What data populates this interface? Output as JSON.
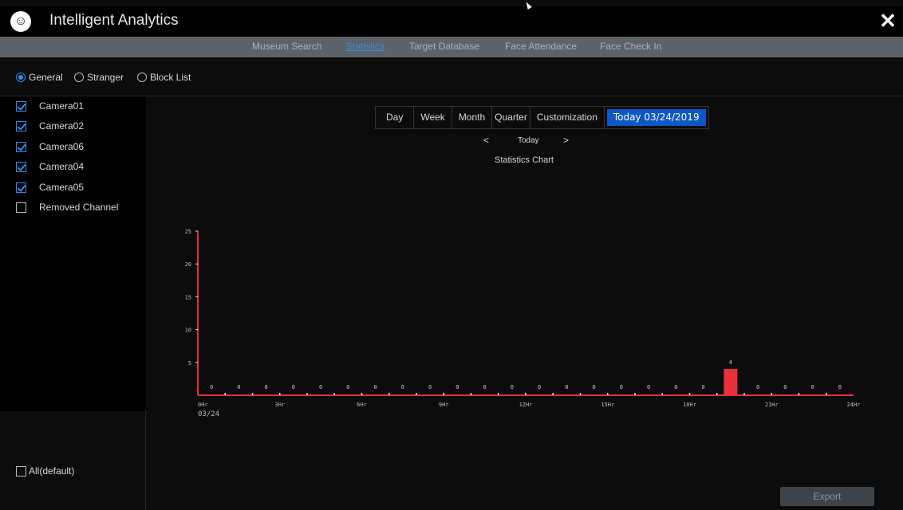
{
  "app": {
    "title": "Intelligent Analytics",
    "logo_icon": "face-logo-icon",
    "close_icon": "close-icon"
  },
  "tabs": [
    {
      "label": "Museum Search",
      "active": false
    },
    {
      "label": "Statistics",
      "active": true
    },
    {
      "label": "Target Database",
      "active": false
    },
    {
      "label": "Face Attendance",
      "active": false
    },
    {
      "label": "Face Check In",
      "active": false
    }
  ],
  "filter_types": [
    {
      "label": "General",
      "checked": true
    },
    {
      "label": "Stranger",
      "checked": false
    },
    {
      "label": "Block List",
      "checked": false
    }
  ],
  "cameras": [
    {
      "label": "Camera01",
      "checked": true
    },
    {
      "label": "Camera02",
      "checked": true
    },
    {
      "label": "Camera06",
      "checked": true
    },
    {
      "label": "Camera04",
      "checked": true
    },
    {
      "label": "Camera05",
      "checked": true
    },
    {
      "label": "Removed Channel",
      "checked": false
    }
  ],
  "all_default": {
    "label": "All(default)",
    "checked": false
  },
  "periods": [
    {
      "label": "Day",
      "active": false
    },
    {
      "label": "Week",
      "active": false
    },
    {
      "label": "Month",
      "active": false
    },
    {
      "label": "Quarter",
      "active": false
    },
    {
      "label": "Customization",
      "active": false
    },
    {
      "label": "Today 03/24/2019",
      "active": true
    }
  ],
  "nav": {
    "prev": "<",
    "label": "Today",
    "next": ">"
  },
  "export_label": "Export",
  "colors": {
    "accent": "#2f8ee6",
    "active_period": "#0d57c6",
    "bar": "#e8303a",
    "axis": "#e8303a"
  },
  "chart_data": {
    "type": "bar",
    "title": "Statistics Chart",
    "date_label": "03/24",
    "x_tick_labels": [
      "0Hr",
      "3Hr",
      "6Hr",
      "9Hr",
      "12Hr",
      "15Hr",
      "18Hr",
      "21Hr",
      "24Hr"
    ],
    "y_ticks": [
      5,
      10,
      15,
      20,
      25
    ],
    "ylim": [
      0,
      25
    ],
    "hours": [
      0,
      1,
      2,
      3,
      4,
      5,
      6,
      7,
      8,
      9,
      10,
      11,
      12,
      13,
      14,
      15,
      16,
      17,
      18,
      19,
      20,
      21,
      22,
      23
    ],
    "values": [
      0,
      0,
      0,
      0,
      0,
      0,
      0,
      0,
      0,
      0,
      0,
      0,
      0,
      0,
      0,
      0,
      0,
      0,
      0,
      4,
      0,
      0,
      0,
      0
    ]
  }
}
